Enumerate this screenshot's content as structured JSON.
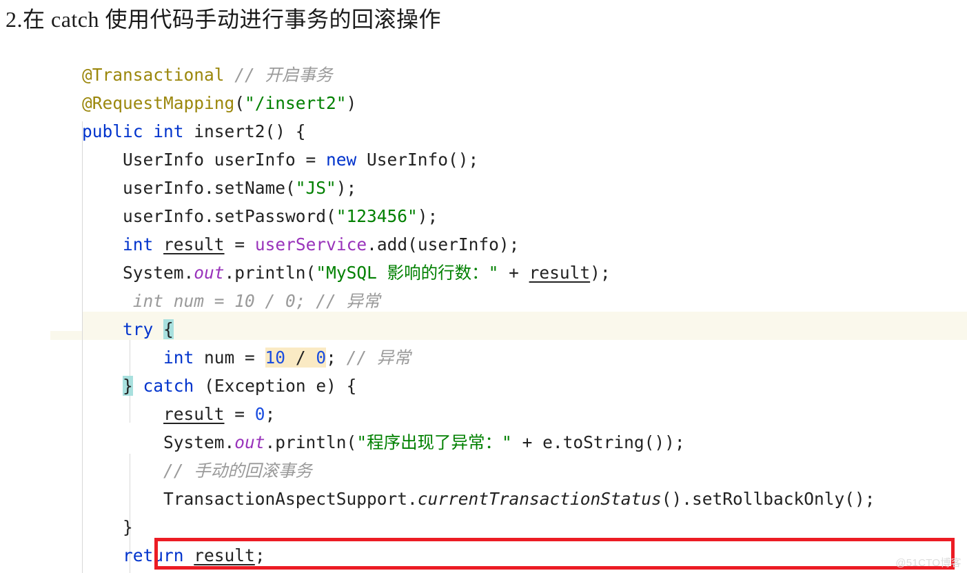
{
  "heading": {
    "text": "2.在 catch 使用代码手动进行事务的回滚操作"
  },
  "watermark": {
    "text": "@51CTO博客"
  },
  "colors": {
    "keyword": "#0033cc",
    "string": "#008000",
    "annotation": "#9b870c",
    "comment": "#9a9a9a",
    "field": "#9933bb",
    "number": "#1a4de0",
    "brace_match_highlight": "#a8e0de",
    "search_highlight": "#faeac4",
    "current_line_highlight": "#faf8ec",
    "emphasis_box": "#ec1c24",
    "default_text": "#222222"
  },
  "code": {
    "language": "java",
    "lines": [
      {
        "n": 1,
        "indent": "",
        "tokens": [
          {
            "t": "@Transactional",
            "c": "ann"
          },
          {
            "t": " ",
            "c": "plain"
          },
          {
            "t": "// 开启事务",
            "c": "cmt"
          }
        ]
      },
      {
        "n": 2,
        "indent": "",
        "tokens": [
          {
            "t": "@RequestMapping",
            "c": "ann"
          },
          {
            "t": "(",
            "c": "plain"
          },
          {
            "t": "\"/insert2\"",
            "c": "str"
          },
          {
            "t": ")",
            "c": "plain"
          }
        ]
      },
      {
        "n": 3,
        "indent": "",
        "tokens": [
          {
            "t": "public",
            "c": "kw"
          },
          {
            "t": " ",
            "c": "plain"
          },
          {
            "t": "int",
            "c": "kw"
          },
          {
            "t": " insert2() {",
            "c": "plain"
          }
        ]
      },
      {
        "n": 4,
        "indent": "    ",
        "tokens": [
          {
            "t": "UserInfo userInfo = ",
            "c": "plain"
          },
          {
            "t": "new",
            "c": "kw"
          },
          {
            "t": " UserInfo();",
            "c": "plain"
          }
        ]
      },
      {
        "n": 5,
        "indent": "    ",
        "tokens": [
          {
            "t": "userInfo.setName(",
            "c": "plain"
          },
          {
            "t": "\"JS\"",
            "c": "str"
          },
          {
            "t": ");",
            "c": "plain"
          }
        ]
      },
      {
        "n": 6,
        "indent": "    ",
        "tokens": [
          {
            "t": "userInfo.setPassword(",
            "c": "plain"
          },
          {
            "t": "\"123456\"",
            "c": "str"
          },
          {
            "t": ");",
            "c": "plain"
          }
        ]
      },
      {
        "n": 7,
        "indent": "    ",
        "tokens": [
          {
            "t": "int",
            "c": "kw"
          },
          {
            "t": " ",
            "c": "plain"
          },
          {
            "t": "result",
            "c": "var-u"
          },
          {
            "t": " = ",
            "c": "plain"
          },
          {
            "t": "userService",
            "c": "fld"
          },
          {
            "t": ".add(userInfo);",
            "c": "plain"
          }
        ]
      },
      {
        "n": 8,
        "indent": "    ",
        "tokens": [
          {
            "t": "System.",
            "c": "plain"
          },
          {
            "t": "out",
            "c": "fld-i"
          },
          {
            "t": ".println(",
            "c": "plain"
          },
          {
            "t": "\"MySQL 影响的行数：\"",
            "c": "str"
          },
          {
            "t": " + ",
            "c": "plain"
          },
          {
            "t": "result",
            "c": "var-u"
          },
          {
            "t": ");",
            "c": "plain"
          }
        ]
      },
      {
        "n": 9,
        "indent": "     ",
        "tokens": [
          {
            "t": "int num = 10 / 0; // 异常",
            "c": "cmt"
          }
        ]
      },
      {
        "n": 10,
        "indent": "    ",
        "current_line": true,
        "tokens": [
          {
            "t": "try",
            "c": "kw"
          },
          {
            "t": " ",
            "c": "plain"
          },
          {
            "t": "{",
            "c": "plain",
            "hl": "brace"
          }
        ]
      },
      {
        "n": 11,
        "indent": "        ",
        "tokens": [
          {
            "t": "int",
            "c": "kw"
          },
          {
            "t": " num = ",
            "c": "plain"
          },
          {
            "t": "10",
            "c": "num",
            "hl": "search"
          },
          {
            "t": " ",
            "c": "plain",
            "hl": "search"
          },
          {
            "t": "/",
            "c": "plain",
            "hl": "search"
          },
          {
            "t": " ",
            "c": "plain",
            "hl": "search"
          },
          {
            "t": "0",
            "c": "num",
            "hl": "search"
          },
          {
            "t": "; ",
            "c": "plain"
          },
          {
            "t": "// 异常",
            "c": "cmt"
          }
        ]
      },
      {
        "n": 12,
        "indent": "    ",
        "tokens": [
          {
            "t": "}",
            "c": "plain",
            "hl": "brace"
          },
          {
            "t": " ",
            "c": "plain"
          },
          {
            "t": "catch",
            "c": "kw"
          },
          {
            "t": " (Exception e) {",
            "c": "plain"
          }
        ]
      },
      {
        "n": 13,
        "indent": "        ",
        "tokens": [
          {
            "t": "result",
            "c": "var-u"
          },
          {
            "t": " = ",
            "c": "plain"
          },
          {
            "t": "0",
            "c": "num"
          },
          {
            "t": ";",
            "c": "plain"
          }
        ]
      },
      {
        "n": 14,
        "indent": "        ",
        "tokens": [
          {
            "t": "System.",
            "c": "plain"
          },
          {
            "t": "out",
            "c": "fld-i"
          },
          {
            "t": ".println(",
            "c": "plain"
          },
          {
            "t": "\"程序出现了异常：\"",
            "c": "str"
          },
          {
            "t": " + e.toString());",
            "c": "plain"
          }
        ]
      },
      {
        "n": 15,
        "indent": "        ",
        "tokens": [
          {
            "t": "// 手动的回滚事务",
            "c": "cmt"
          }
        ]
      },
      {
        "n": 16,
        "indent": "        ",
        "boxed": true,
        "tokens": [
          {
            "t": "TransactionAspectSupport.",
            "c": "plain"
          },
          {
            "t": "currentTransactionStatus",
            "c": "stat-i"
          },
          {
            "t": "().setRollbackOnly();",
            "c": "plain"
          }
        ]
      },
      {
        "n": 17,
        "indent": "    ",
        "tokens": [
          {
            "t": "}",
            "c": "plain"
          }
        ]
      },
      {
        "n": 18,
        "indent": "    ",
        "tokens": [
          {
            "t": "return",
            "c": "kw"
          },
          {
            "t": " ",
            "c": "plain"
          },
          {
            "t": "result",
            "c": "var-u"
          },
          {
            "t": ";",
            "c": "plain"
          }
        ]
      }
    ]
  }
}
